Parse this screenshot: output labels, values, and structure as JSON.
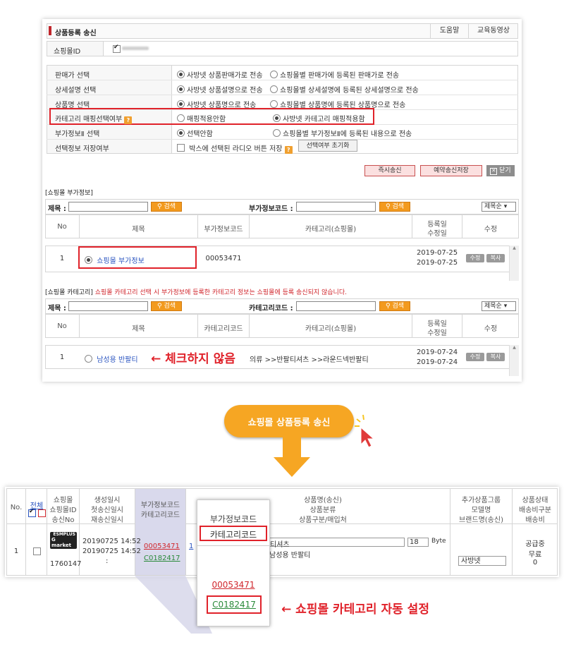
{
  "form": {
    "title": "상품등록 송신",
    "help": "도움말",
    "edu": "교육동영상",
    "mall_id_label": "쇼핑몰ID",
    "rows": [
      {
        "label": "판매가 선택",
        "opt1": "사방넷 상품판매가로 전송",
        "opt2": "쇼핑몰별 판매가에 등록된 판매가로 전송"
      },
      {
        "label": "상세설명 선택",
        "opt1": "사방넷 상품설명으로 전송",
        "opt2": "쇼핑몰별 상세설명에 등록된 상세설명으로 전송"
      },
      {
        "label": "상품명 선택",
        "opt1": "사방넷 상품명으로 전송",
        "opt2": "쇼핑몰별 상품명에 등록된 상품명으로 전송"
      },
      {
        "label": "카테고리 매핑선택여부",
        "opt1": "매핑적용안함",
        "opt2": "사방넷 카테고리 매핑적용함"
      },
      {
        "label": "부가정보Ⅱ 선택",
        "opt1": "선택안함",
        "opt2": "쇼핑몰별 부가정보Ⅱ에 등록된 내용으로 전송"
      },
      {
        "label": "선택정보 저장여부",
        "opt1": "박스에 선택된 라디오 버튼 저장",
        "reset": "선택여부 초기화"
      }
    ],
    "btn_send": "즉시송신",
    "btn_reserve": "예약송신저장",
    "btn_close": "닫기"
  },
  "addinfo": {
    "section": "[쇼핑몰 부가정보]",
    "title_label": "제목 :",
    "search": "검색",
    "code_label": "부가정보코드 :",
    "sort": "제목순",
    "cols": [
      "No",
      "제목",
      "부가정보코드",
      "카테고리(쇼핑몰)",
      "등록일",
      "수정일",
      "수정"
    ],
    "row": {
      "no": "1",
      "title": "쇼핑몰 부가정보",
      "code": "00053471",
      "reg": "2019-07-25",
      "mod": "2019-07-25",
      "edit": "수정",
      "copy": "복사"
    }
  },
  "category": {
    "section_prefix": "[쇼핑몰 카테고리]",
    "section_note": "쇼핑몰 카테고리 선택 시 부가정보에 등록한 카테고리 정보는 쇼핑몰에 등록 송신되지 않습니다.",
    "title_label": "제목 :",
    "search": "검색",
    "code_label": "카테고리코드 :",
    "sort": "제목순",
    "cols": [
      "No",
      "제목",
      "카테고리코드",
      "카테고리(쇼핑몰)",
      "등록일",
      "수정일",
      "수정"
    ],
    "row": {
      "no": "1",
      "title": "남성용 반팔티",
      "cat": "의류 >>반팔티셔츠 >>라운드넥반팔티",
      "reg": "2019-07-24",
      "mod": "2019-07-24",
      "edit": "수정",
      "copy": "복사"
    },
    "callout": "← 체크하지 않음"
  },
  "flow_label": "쇼핑몰 상품등록 송신",
  "result": {
    "h_no": "No.",
    "h_all": "전체",
    "h_mall": [
      "쇼핑몰",
      "쇼핑몰ID",
      "송신No"
    ],
    "h_dates": [
      "생성일시",
      "첫송신일시",
      "재송신일시"
    ],
    "h_codes": [
      "부가정보코드",
      "카테고리코드"
    ],
    "h_prod": [
      "상품명(송신)",
      "상품분류",
      "상품구분/매입처"
    ],
    "h_extra": [
      "추가상품그룹",
      "모델명",
      "브랜드명(송신)"
    ],
    "h_status": [
      "상품상태",
      "배송비구분",
      "배송비"
    ],
    "row": {
      "no": "1",
      "logo_top": "ESMPLUS",
      "logo_bottom": "G market",
      "send_no": "1760147",
      "created": "20190725 14:52",
      "first": "20190725 14:52",
      "resend": ":",
      "code1": "00053471",
      "code2": "C0182417",
      "prod_name": "티셔츠",
      "byte_val": "18",
      "byte_unit": "Byte",
      "category": "남성용 반팔티",
      "brand": "사방넷",
      "status": "공급중",
      "ship_type": "무료",
      "ship_fee": "0"
    },
    "zoom": {
      "h1": "부가정보코드",
      "h2": "카테고리코드",
      "code1": "00053471",
      "code2": "C0182417"
    },
    "callout": "← 쇼핑몰 카테고리 자동 설정"
  }
}
